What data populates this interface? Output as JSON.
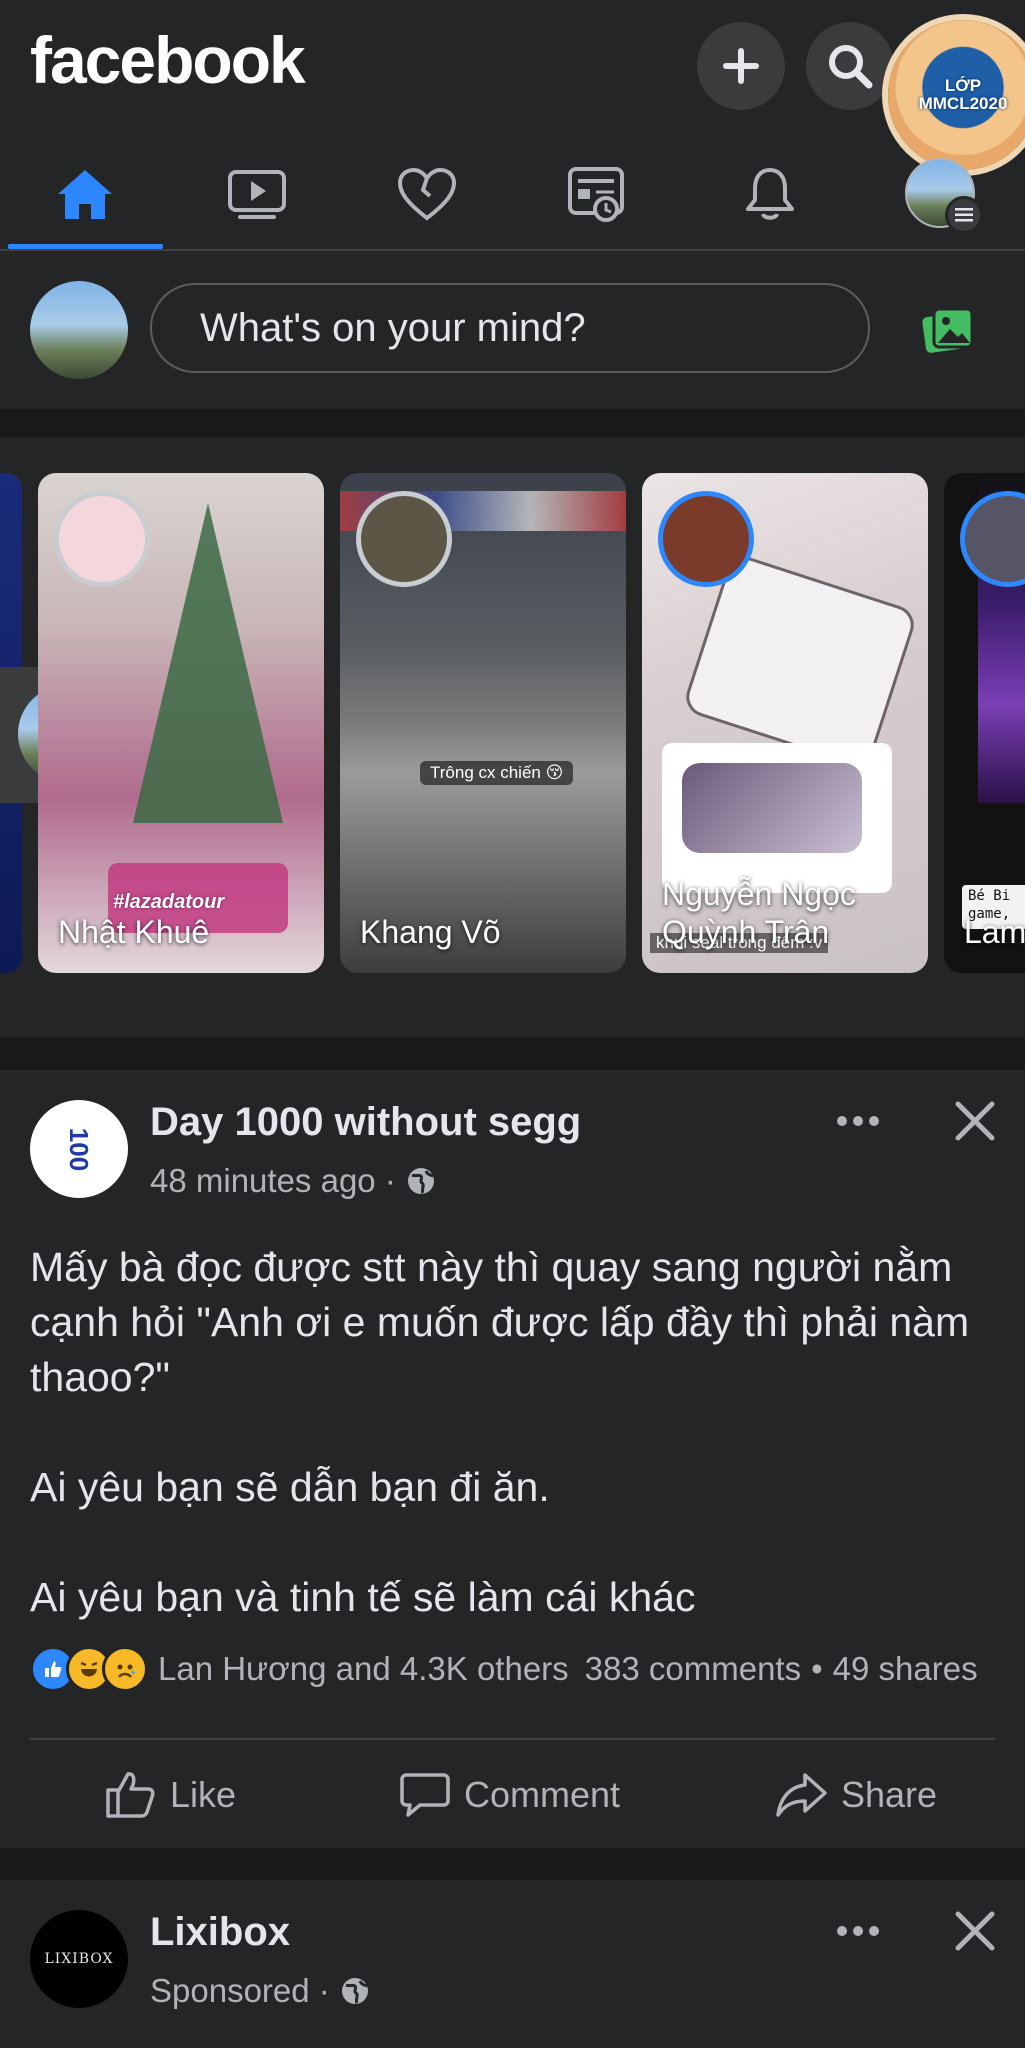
{
  "header": {
    "logo": "facebook",
    "badge_lines": [
      "LỚP",
      "MMCL2020"
    ],
    "nav_tabs": [
      {
        "name": "home",
        "icon": "home-icon",
        "active": true
      },
      {
        "name": "watch",
        "icon": "video-icon",
        "active": false
      },
      {
        "name": "dating",
        "icon": "heart-icon",
        "active": false
      },
      {
        "name": "news",
        "icon": "news-feed-icon",
        "active": false
      },
      {
        "name": "notifications",
        "icon": "bell-icon",
        "active": false
      },
      {
        "name": "menu",
        "icon": "profile-menu-icon",
        "active": false
      }
    ],
    "accent": "#2d88ff"
  },
  "composer": {
    "placeholder": "What's on your mind?",
    "photo_icon": "photo-icon",
    "photo_color": "#45bd62"
  },
  "stories": [
    {
      "name": "Nhật Khuê",
      "overlay_text": "#lazadatour"
    },
    {
      "name": "Khang Võ",
      "overlay_text": "Trông cx chiến 😚"
    },
    {
      "name": "Nguyễn Ngọc\nQuỳnh Trân",
      "overlay_text": "khui seal trong đêm :v"
    },
    {
      "name": "Lam",
      "overlay_text": "Bé Bi\ngame,"
    }
  ],
  "post1": {
    "author": "Day 1000 without segg",
    "time": "48 minutes ago ·",
    "paragraphs": [
      "Mấy bà đọc được stt này thì quay sang người nằm cạnh hỏi \"Anh ơi e muốn được lấp đầy thì phải nàm thaoo?\"",
      "Ai yêu bạn sẽ dẫn bạn đi ăn.",
      "Ai yêu bạn và tinh tế sẽ làm cái khác"
    ],
    "reactions_text": "Lan Hương and 4.3K others",
    "comments": "383 comments",
    "separator": "•",
    "shares": "49 shares",
    "actions": {
      "like": "Like",
      "comment": "Comment",
      "share": "Share"
    }
  },
  "post2": {
    "author": "Lixibox",
    "time": "Sponsored ·",
    "avatar_text": "LIXIBOX"
  }
}
